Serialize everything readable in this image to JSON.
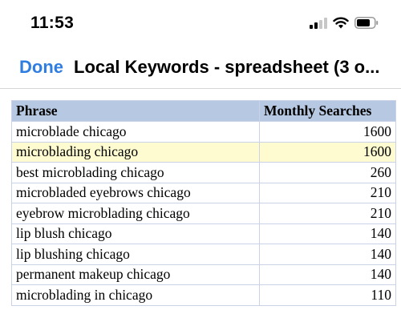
{
  "status_bar": {
    "time": "11:53",
    "icons": [
      "cellular-signal-icon",
      "wifi-icon",
      "battery-icon"
    ]
  },
  "nav": {
    "done_label": "Done",
    "title": "Local Keywords - spreadsheet (3 o..."
  },
  "colors": {
    "accent": "#2f7de1",
    "header_fill": "#b7c8e2",
    "highlight_fill": "#fdfbcf"
  },
  "table": {
    "headers": [
      "Phrase",
      "Monthly Searches"
    ],
    "highlighted_row": 1,
    "rows": [
      {
        "phrase": "microblade chicago",
        "searches": "1600"
      },
      {
        "phrase": "microblading chicago",
        "searches": "1600"
      },
      {
        "phrase": "best microblading chicago",
        "searches": "260"
      },
      {
        "phrase": "microbladed eyebrows chicago",
        "searches": "210"
      },
      {
        "phrase": "eyebrow microblading chicago",
        "searches": "210"
      },
      {
        "phrase": "lip blush chicago",
        "searches": "140"
      },
      {
        "phrase": "lip blushing chicago",
        "searches": "140"
      },
      {
        "phrase": "permanent makeup chicago",
        "searches": "140"
      },
      {
        "phrase": "microblading in chicago",
        "searches": "110"
      }
    ]
  }
}
